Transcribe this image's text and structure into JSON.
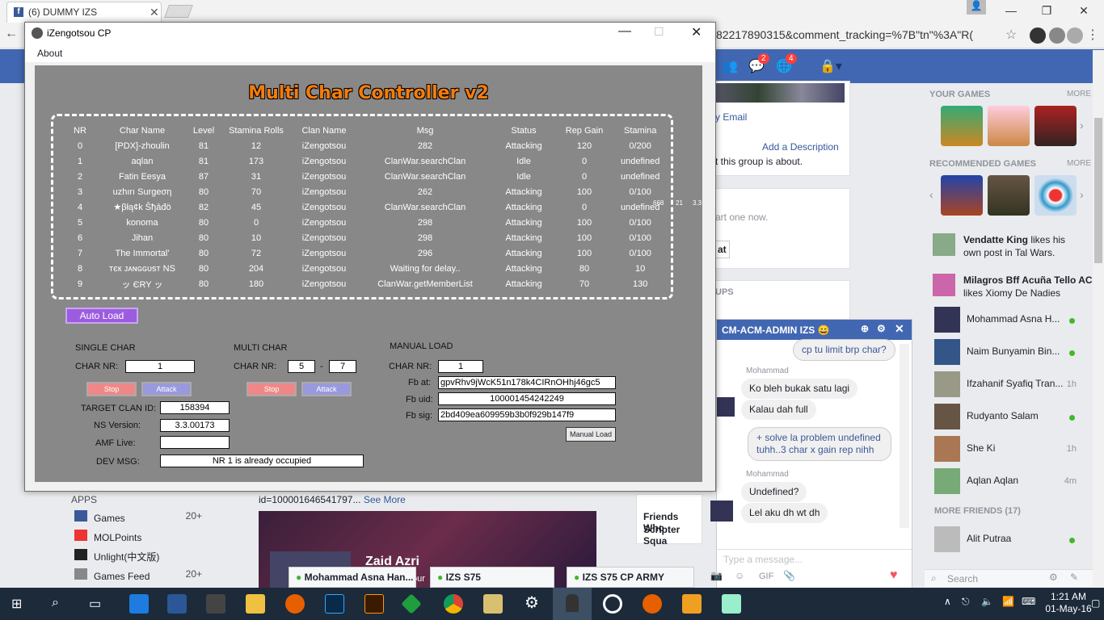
{
  "browser": {
    "tab_title": "(6) DUMMY IZS",
    "tab_close": "✕",
    "url": "82217890315&comment_tracking=%7B\"tn\"%3A\"R(",
    "window_min": "—",
    "window_max": "❐",
    "window_close": "✕"
  },
  "fb_header": {
    "badge_msgs": "2",
    "badge_notif": "4"
  },
  "left_col": {
    "apps_title": "APPS",
    "items": [
      {
        "label": "Games",
        "count": "20+"
      },
      {
        "label": "MOLPoints",
        "count": ""
      },
      {
        "label": "Unlight(中文版)",
        "count": ""
      },
      {
        "label": "Games Feed",
        "count": "20+"
      }
    ]
  },
  "center": {
    "email": "y Email",
    "add_desc": "Add a Description",
    "desc": "t this group is about.",
    "start": "art one now.",
    "at": "at",
    "ups": "UPS",
    "friends_who": "Friends Who",
    "scripter": "Scripter Squa",
    "post_id": "id=100001646541797...",
    "see_more": "See More",
    "post_name": "Zaid Azri",
    "post_sub": "our"
  },
  "right_col": {
    "your_games": "YOUR GAMES",
    "more": "MORE",
    "recommended": "RECOMMENDED GAMES",
    "more2": "MORE",
    "ticker": [
      {
        "name": "Vendatte King",
        "text": " likes his own post in Tal Wars."
      },
      {
        "name": "Milagros Bff Acuña Tello AC",
        "text": " likes Xiomy De Nadies"
      }
    ],
    "friends": [
      {
        "name": "Mohammad Asna H...",
        "status": "online"
      },
      {
        "name": "Naim Bunyamin Bin...",
        "status": "online"
      },
      {
        "name": "Ifzahanif Syafiq Tran...",
        "status": "1h"
      },
      {
        "name": "Rudyanto Salam",
        "status": "online"
      },
      {
        "name": "She Ki",
        "status": "1h"
      },
      {
        "name": "Aqlan Aqlan",
        "status": "4m"
      }
    ],
    "more_friends": "MORE FRIENDS (17)",
    "extra_friend": "Alit Putraa",
    "search": "Search"
  },
  "chat": {
    "title": "CM-ACM-ADMIN IZS 😄",
    "msg0": "cp tu limit brp char?",
    "sender1": "Mohammad",
    "msg1": "Ko bleh bukak satu lagi",
    "msg2": "Kalau dah full",
    "msg3": "+ solve la problem undefined tuhh..3 char x gain rep nihh",
    "sender2": "Mohammad",
    "msg4": "Undefined?",
    "msg5": "Lel aku dh wt dh",
    "placeholder": "Type a message...",
    "gif": "GIF"
  },
  "chat_tabs": [
    {
      "label": "Mohammad Asna Han..."
    },
    {
      "label": "IZS S75"
    },
    {
      "label": "IZS S75 CP ARMY"
    }
  ],
  "app": {
    "title": "iZengotsou CP",
    "menu_about": "About",
    "heading": "Multi Char Controller v2",
    "columns": [
      "NR",
      "Char Name",
      "Level",
      "Stamina Rolls",
      "Clan Name",
      "Msg",
      "Status",
      "Rep Gain",
      "Stamina"
    ],
    "rows": [
      [
        "0",
        "[PDX]-zhoulin",
        "81",
        "12",
        "iZengotsou",
        "282",
        "Attacking",
        "120",
        "0/200"
      ],
      [
        "1",
        "aqlan",
        "81",
        "173",
        "iZengotsou",
        "ClanWar.searchClan",
        "Idle",
        "0",
        "undefined"
      ],
      [
        "2",
        "Fatin Eesya",
        "87",
        "31",
        "iZengotsou",
        "ClanWar.searchClan",
        "Idle",
        "0",
        "undefined"
      ],
      [
        "3",
        "uzhırı Surgeση",
        "80",
        "70",
        "iZengotsou",
        "262",
        "Attacking",
        "100",
        "0/100"
      ],
      [
        "4",
        "★βłą¢k Ŝђāđö",
        "82",
        "45",
        "iZengotsou",
        "ClanWar.searchClan",
        "Attacking",
        "0",
        "undefined"
      ],
      [
        "5",
        "konoma",
        "80",
        "0",
        "iZengotsou",
        "298",
        "Attacking",
        "100",
        "0/100"
      ],
      [
        "6",
        "Jihan",
        "80",
        "10",
        "iZengotsou",
        "298",
        "Attacking",
        "100",
        "0/100"
      ],
      [
        "7",
        "The Immortal'",
        "80",
        "72",
        "iZengotsou",
        "296",
        "Attacking",
        "100",
        "0/100"
      ],
      [
        "8",
        "тєк ᴊᴀɴɢɢᴜsᴛ NS",
        "80",
        "204",
        "iZengotsou",
        "Waiting for delay..",
        "Attacking",
        "80",
        "10"
      ],
      [
        "9",
        "ッ ЄRY ッ",
        "80",
        "180",
        "iZengotsou",
        "ClanWar.getMemberList",
        "Attacking",
        "70",
        "130"
      ]
    ],
    "overflow_a": "668",
    "overflow_b": "21",
    "overflow_c": "3.3",
    "auto_load": "Auto Load",
    "single": {
      "title": "SINGLE CHAR",
      "nr_label": "CHAR NR:",
      "nr": "1",
      "stop": "Stop",
      "attack": "Attack"
    },
    "multi": {
      "title": "MULTI CHAR",
      "nr_label": "CHAR NR:",
      "from": "5",
      "dash": "-",
      "to": "7",
      "stop": "Stop",
      "attack": "Attack"
    },
    "target_label": "TARGET CLAN ID:",
    "target": "158394",
    "ns_label": "NS Version:",
    "ns": "3.3.00173",
    "amf_label": "AMF Live:",
    "amf": "",
    "dev_label": "DEV MSG:",
    "dev": "NR 1 is already occupied",
    "manual": {
      "title": "MANUAL LOAD",
      "nr_label": "CHAR NR:",
      "nr": "1",
      "fbat_label": "Fb at:",
      "fbat": "gpvRhv9jWcK51n178k4CIRnOHhj46gc5",
      "fbuid_label": "Fb uid:",
      "fbuid": "100001454242249",
      "fbsig_label": "Fb sig:",
      "fbsig": "2bd409ea609959b3b0f929b147f9",
      "button": "Manual Load"
    }
  },
  "taskbar": {
    "time": "1:21 AM",
    "date": "01-May-16"
  }
}
